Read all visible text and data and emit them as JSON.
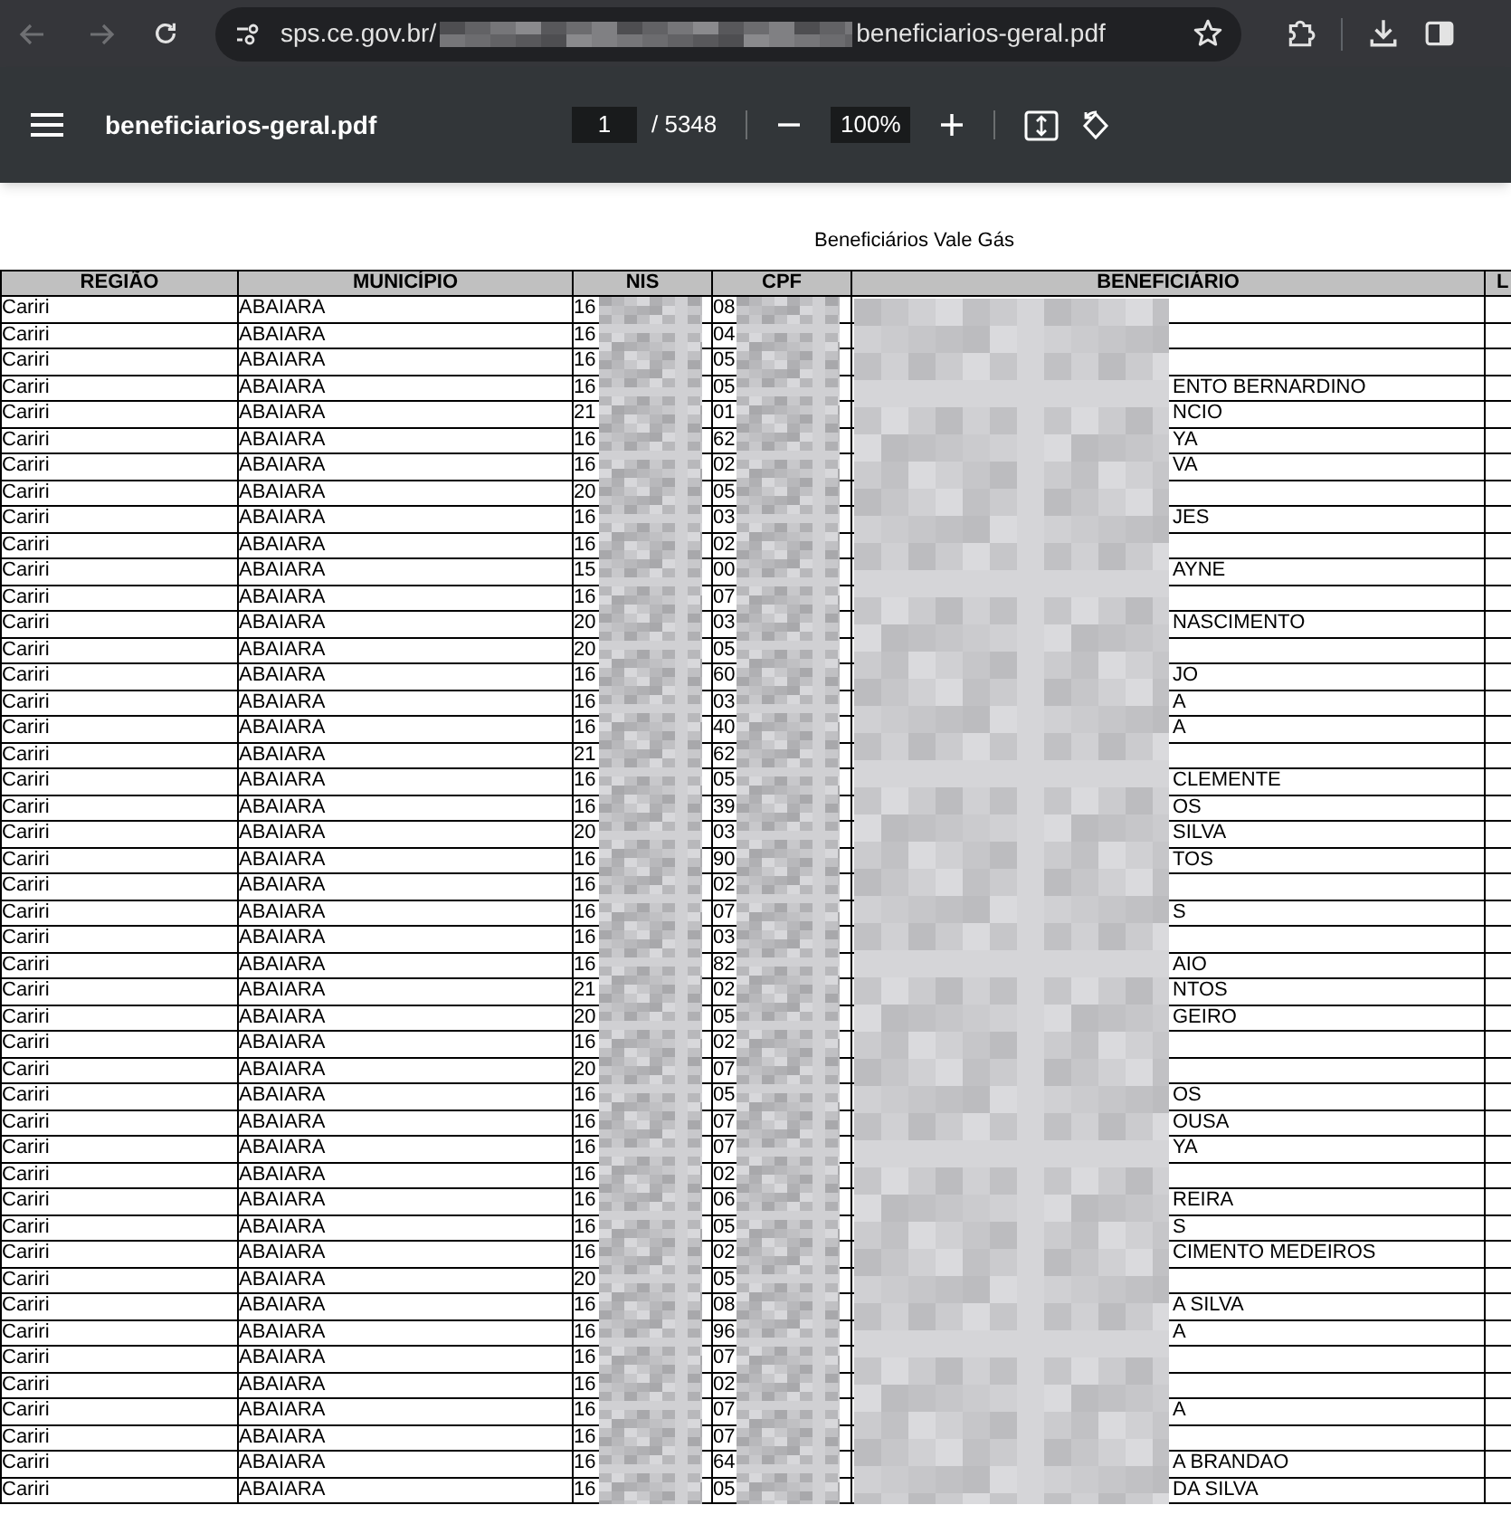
{
  "browser": {
    "url_host": "sps.ce.gov.br/",
    "url_file": "beneficiarios-geral.pdf"
  },
  "viewer": {
    "title": "beneficiarios-geral.pdf",
    "page": "1",
    "page_count": "/ 5348",
    "zoom": "100%"
  },
  "document": {
    "title": "Beneficiários Vale Gás",
    "table": {
      "columns": [
        "REGIÃO",
        "MUNICÍPIO",
        "NIS",
        "CPF",
        "BENEFICIÁRIO",
        "L"
      ],
      "rows": [
        {
          "regiao": "Cariri",
          "municipio": "ABAIARA",
          "nis": "16",
          "cpf": "08"
        },
        {
          "regiao": "Cariri",
          "municipio": "ABAIARA",
          "nis": "16",
          "cpf": "04"
        },
        {
          "regiao": "Cariri",
          "municipio": "ABAIARA",
          "nis": "16",
          "cpf": "05"
        },
        {
          "regiao": "Cariri",
          "municipio": "ABAIARA",
          "nis": "16",
          "cpf": "05",
          "beneficiario": "ENTO BERNARDINO"
        },
        {
          "regiao": "Cariri",
          "municipio": "ABAIARA",
          "nis": "21",
          "cpf": "01",
          "beneficiario": "NCIO"
        },
        {
          "regiao": "Cariri",
          "municipio": "ABAIARA",
          "nis": "16",
          "cpf": "62",
          "beneficiario": "YA"
        },
        {
          "regiao": "Cariri",
          "municipio": "ABAIARA",
          "nis": "16",
          "cpf": "02",
          "beneficiario": "VA"
        },
        {
          "regiao": "Cariri",
          "municipio": "ABAIARA",
          "nis": "20",
          "cpf": "05"
        },
        {
          "regiao": "Cariri",
          "municipio": "ABAIARA",
          "nis": "16",
          "cpf": "03",
          "beneficiario": "JES"
        },
        {
          "regiao": "Cariri",
          "municipio": "ABAIARA",
          "nis": "16",
          "cpf": "02"
        },
        {
          "regiao": "Cariri",
          "municipio": "ABAIARA",
          "nis": "15",
          "cpf": "00",
          "beneficiario": "AYNE"
        },
        {
          "regiao": "Cariri",
          "municipio": "ABAIARA",
          "nis": "16",
          "cpf": "07"
        },
        {
          "regiao": "Cariri",
          "municipio": "ABAIARA",
          "nis": "20",
          "cpf": "03",
          "beneficiario": "NASCIMENTO"
        },
        {
          "regiao": "Cariri",
          "municipio": "ABAIARA",
          "nis": "20",
          "cpf": "05"
        },
        {
          "regiao": "Cariri",
          "municipio": "ABAIARA",
          "nis": "16",
          "cpf": "60",
          "beneficiario": "JO"
        },
        {
          "regiao": "Cariri",
          "municipio": "ABAIARA",
          "nis": "16",
          "cpf": "03",
          "beneficiario": "A"
        },
        {
          "regiao": "Cariri",
          "municipio": "ABAIARA",
          "nis": "16",
          "cpf": "40",
          "beneficiario": "A"
        },
        {
          "regiao": "Cariri",
          "municipio": "ABAIARA",
          "nis": "21",
          "cpf": "62"
        },
        {
          "regiao": "Cariri",
          "municipio": "ABAIARA",
          "nis": "16",
          "cpf": "05",
          "beneficiario": "CLEMENTE"
        },
        {
          "regiao": "Cariri",
          "municipio": "ABAIARA",
          "nis": "16",
          "cpf": "39",
          "beneficiario": "OS"
        },
        {
          "regiao": "Cariri",
          "municipio": "ABAIARA",
          "nis": "20",
          "cpf": "03",
          "beneficiario": "SILVA"
        },
        {
          "regiao": "Cariri",
          "municipio": "ABAIARA",
          "nis": "16",
          "cpf": "90",
          "beneficiario": "TOS"
        },
        {
          "regiao": "Cariri",
          "municipio": "ABAIARA",
          "nis": "16",
          "cpf": "02"
        },
        {
          "regiao": "Cariri",
          "municipio": "ABAIARA",
          "nis": "16",
          "cpf": "07",
          "beneficiario": "S"
        },
        {
          "regiao": "Cariri",
          "municipio": "ABAIARA",
          "nis": "16",
          "cpf": "03"
        },
        {
          "regiao": "Cariri",
          "municipio": "ABAIARA",
          "nis": "16",
          "cpf": "82",
          "beneficiario": "AIO"
        },
        {
          "regiao": "Cariri",
          "municipio": "ABAIARA",
          "nis": "21",
          "cpf": "02",
          "beneficiario": "NTOS"
        },
        {
          "regiao": "Cariri",
          "municipio": "ABAIARA",
          "nis": "20",
          "cpf": "05",
          "beneficiario": "GEIRO"
        },
        {
          "regiao": "Cariri",
          "municipio": "ABAIARA",
          "nis": "16",
          "cpf": "02"
        },
        {
          "regiao": "Cariri",
          "municipio": "ABAIARA",
          "nis": "20",
          "cpf": "07"
        },
        {
          "regiao": "Cariri",
          "municipio": "ABAIARA",
          "nis": "16",
          "cpf": "05",
          "beneficiario": "OS"
        },
        {
          "regiao": "Cariri",
          "municipio": "ABAIARA",
          "nis": "16",
          "cpf": "07",
          "beneficiario": "OUSA"
        },
        {
          "regiao": "Cariri",
          "municipio": "ABAIARA",
          "nis": "16",
          "cpf": "07",
          "beneficiario": "YA"
        },
        {
          "regiao": "Cariri",
          "municipio": "ABAIARA",
          "nis": "16",
          "cpf": "02"
        },
        {
          "regiao": "Cariri",
          "municipio": "ABAIARA",
          "nis": "16",
          "cpf": "06",
          "beneficiario": "REIRA"
        },
        {
          "regiao": "Cariri",
          "municipio": "ABAIARA",
          "nis": "16",
          "cpf": "05",
          "beneficiario": "S"
        },
        {
          "regiao": "Cariri",
          "municipio": "ABAIARA",
          "nis": "16",
          "cpf": "02",
          "beneficiario": "CIMENTO MEDEIROS"
        },
        {
          "regiao": "Cariri",
          "municipio": "ABAIARA",
          "nis": "20",
          "cpf": "05"
        },
        {
          "regiao": "Cariri",
          "municipio": "ABAIARA",
          "nis": "16",
          "cpf": "08",
          "beneficiario": "A SILVA"
        },
        {
          "regiao": "Cariri",
          "municipio": "ABAIARA",
          "nis": "16",
          "cpf": "96",
          "beneficiario": "A"
        },
        {
          "regiao": "Cariri",
          "municipio": "ABAIARA",
          "nis": "16",
          "cpf": "07"
        },
        {
          "regiao": "Cariri",
          "municipio": "ABAIARA",
          "nis": "16",
          "cpf": "02"
        },
        {
          "regiao": "Cariri",
          "municipio": "ABAIARA",
          "nis": "16",
          "cpf": "07",
          "beneficiario": "A"
        },
        {
          "regiao": "Cariri",
          "municipio": "ABAIARA",
          "nis": "16",
          "cpf": "07"
        },
        {
          "regiao": "Cariri",
          "municipio": "ABAIARA",
          "nis": "16",
          "cpf": "64",
          "beneficiario": "A BRANDAO"
        },
        {
          "regiao": "Cariri",
          "municipio": "ABAIARA",
          "nis": "16",
          "cpf": "05",
          "beneficiario": "DA SILVA"
        }
      ]
    }
  }
}
